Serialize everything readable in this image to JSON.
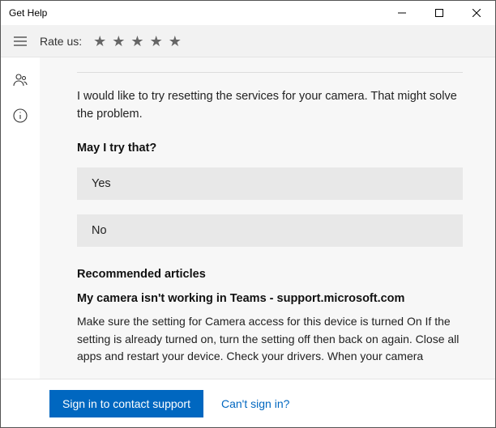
{
  "window": {
    "title": "Get Help"
  },
  "rate": {
    "label": "Rate us:"
  },
  "chat": {
    "message": "I would like to try resetting the services for your camera. That might solve the problem.",
    "question": "May I try that?",
    "options": {
      "yes": "Yes",
      "no": "No"
    }
  },
  "recommended": {
    "heading": "Recommended articles",
    "article_title": "My camera isn't working in Teams - support.microsoft.com",
    "article_text": "Make sure the setting for Camera access for this device is turned On If the setting is already turned on, turn the setting off then back on again. Close all apps and restart your device. Check your drivers. When your camera"
  },
  "footer": {
    "signin": "Sign in to contact support",
    "cant": "Can't sign in?"
  }
}
